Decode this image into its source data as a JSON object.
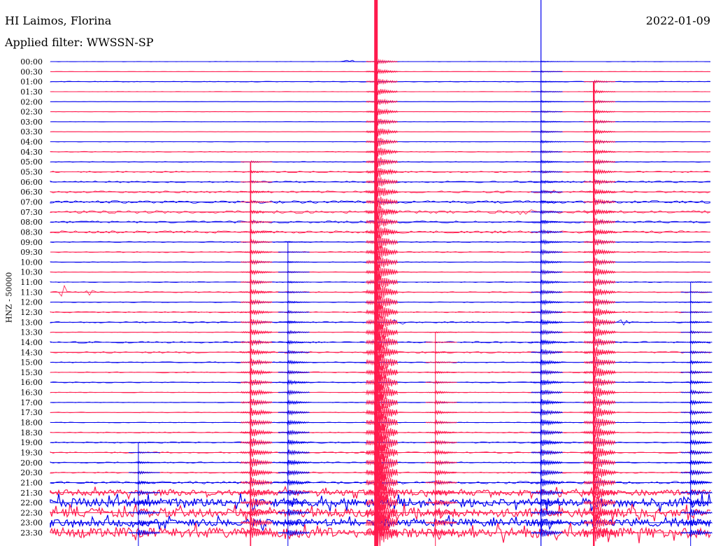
{
  "header": {
    "station": "HI Laimos, Florina",
    "filter": "Applied filter: WWSSN-SP",
    "date": "2022-01-09"
  },
  "chart_data": {
    "type": "line",
    "title": "HI Laimos, Florina",
    "subtitle": "Applied filter: WWSSN-SP",
    "date": "2022-01-09",
    "ylabel": "HNZ - 50000",
    "row_labels": [
      "00:00",
      "00:30",
      "01:00",
      "01:30",
      "02:00",
      "02:30",
      "03:00",
      "03:30",
      "04:00",
      "04:30",
      "05:00",
      "05:30",
      "06:00",
      "06:30",
      "07:00",
      "07:30",
      "08:00",
      "08:30",
      "09:00",
      "09:30",
      "10:00",
      "10:30",
      "11:00",
      "11:30",
      "12:00",
      "12:30",
      "13:00",
      "13:30",
      "14:00",
      "14:30",
      "15:00",
      "15:30",
      "16:00",
      "16:30",
      "17:00",
      "17:30",
      "18:00",
      "18:30",
      "19:00",
      "19:30",
      "20:00",
      "20:30",
      "21:00",
      "21:30",
      "22:00",
      "22:30",
      "23:00",
      "23:30"
    ],
    "trace_colors": [
      "#0000ee",
      "#ff1a4d"
    ],
    "minutes_per_row": 30,
    "rows": [
      {
        "noise": 0.3,
        "events": [
          {
            "minute": 13.5,
            "amp": 4
          }
        ]
      },
      {
        "noise": 0.2,
        "events": []
      },
      {
        "noise": 0.6,
        "events": []
      },
      {
        "noise": 0.3,
        "events": []
      },
      {
        "noise": 0.3,
        "events": []
      },
      {
        "noise": 0.3,
        "events": []
      },
      {
        "noise": 0.3,
        "events": []
      },
      {
        "noise": 0.3,
        "events": []
      },
      {
        "noise": 0.3,
        "events": []
      },
      {
        "noise": 0.6,
        "events": []
      },
      {
        "noise": 0.6,
        "events": []
      },
      {
        "noise": 1.0,
        "events": []
      },
      {
        "noise": 1.2,
        "events": []
      },
      {
        "noise": 1.5,
        "events": [
          {
            "minute": 23.0,
            "amp": 4
          }
        ]
      },
      {
        "noise": 2.0,
        "events": []
      },
      {
        "noise": 2.2,
        "events": [
          {
            "minute": 21.5,
            "amp": 8
          }
        ]
      },
      {
        "noise": 1.5,
        "events": []
      },
      {
        "noise": 1.8,
        "events": []
      },
      {
        "noise": 0.8,
        "events": []
      },
      {
        "noise": 0.8,
        "events": []
      },
      {
        "noise": 0.5,
        "events": []
      },
      {
        "noise": 0.5,
        "events": []
      },
      {
        "noise": 0.6,
        "events": []
      },
      {
        "noise": 0.8,
        "events": [
          {
            "minute": 0.6,
            "amp": 10
          },
          {
            "minute": 1.9,
            "amp": 5
          }
        ]
      },
      {
        "noise": 0.6,
        "events": []
      },
      {
        "noise": 0.8,
        "events": []
      },
      {
        "noise": 1.0,
        "events": [
          {
            "minute": 15.7,
            "amp": 8
          },
          {
            "minute": 26.0,
            "amp": 6
          }
        ]
      },
      {
        "noise": 0.5,
        "events": []
      },
      {
        "noise": 1.2,
        "events": []
      },
      {
        "noise": 1.2,
        "events": []
      },
      {
        "noise": 0.8,
        "events": []
      },
      {
        "noise": 0.8,
        "events": []
      },
      {
        "noise": 0.8,
        "events": []
      },
      {
        "noise": 0.5,
        "events": []
      },
      {
        "noise": 0.5,
        "events": []
      },
      {
        "noise": 0.5,
        "events": []
      },
      {
        "noise": 0.5,
        "events": []
      },
      {
        "noise": 0.8,
        "events": []
      },
      {
        "noise": 1.0,
        "events": []
      },
      {
        "noise": 1.0,
        "events": []
      },
      {
        "noise": 1.0,
        "events": []
      },
      {
        "noise": 1.0,
        "events": []
      },
      {
        "noise": 2.0,
        "events": []
      },
      {
        "noise": 4.0,
        "events": []
      },
      {
        "noise": 6.0,
        "events": []
      },
      {
        "noise": 6.0,
        "events": []
      },
      {
        "noise": 5.0,
        "events": []
      },
      {
        "noise": 7.0,
        "events": []
      }
    ],
    "spikes": [
      {
        "minute": 14.8,
        "row_from": 0,
        "row_to": 47,
        "amp": 60,
        "color": "#ff1a4d"
      },
      {
        "minute": 22.3,
        "row_from": 0,
        "row_to": 47,
        "amp": 14,
        "color": "#0000ee"
      },
      {
        "minute": 9.1,
        "row_from": 10,
        "row_to": 47,
        "amp": 20,
        "color": "#ff1a4d"
      },
      {
        "minute": 10.8,
        "row_from": 18,
        "row_to": 47,
        "amp": 12,
        "color": "#0000ee"
      },
      {
        "minute": 17.5,
        "row_from": 27,
        "row_to": 47,
        "amp": 12,
        "color": "#ff1a4d"
      },
      {
        "minute": 24.7,
        "row_from": 2,
        "row_to": 47,
        "amp": 30,
        "color": "#ff1a4d"
      },
      {
        "minute": 29.1,
        "row_from": 22,
        "row_to": 47,
        "amp": 12,
        "color": "#0000ee"
      },
      {
        "minute": 4.0,
        "row_from": 38,
        "row_to": 47,
        "amp": 10,
        "color": "#0000ee"
      }
    ]
  }
}
